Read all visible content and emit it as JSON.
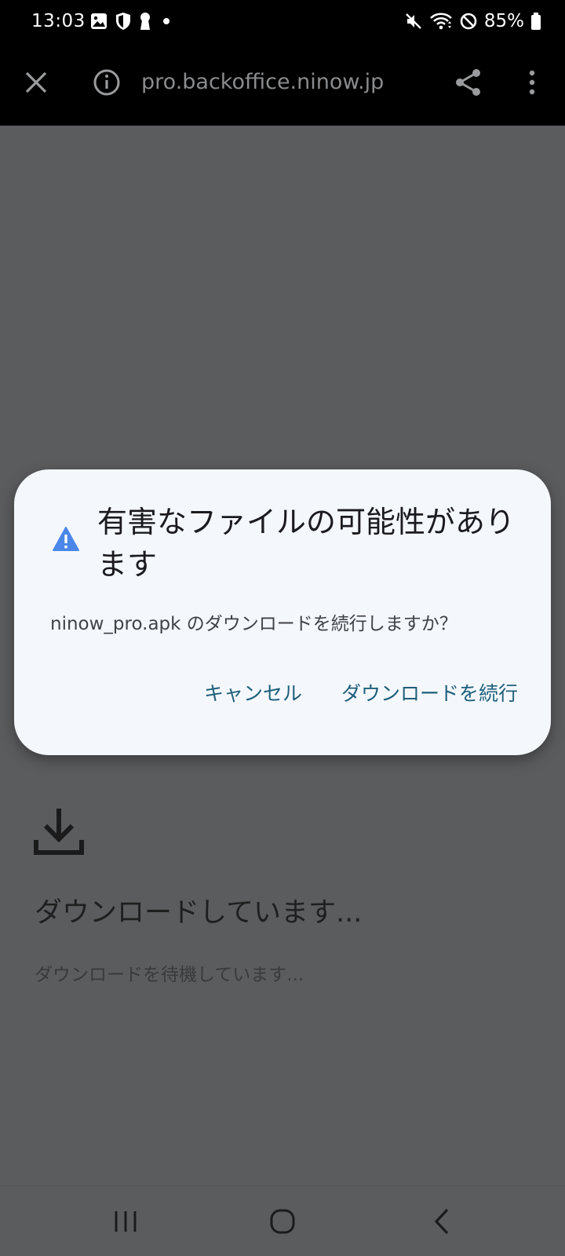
{
  "status_bar": {
    "time": "13:03",
    "battery_text": "85%",
    "icons_left": [
      "gallery-icon",
      "shield-icon",
      "keyhole-icon",
      "dot-icon"
    ],
    "icons_right": [
      "mute-icon",
      "wifi-icon",
      "blocked-icon",
      "battery-icon"
    ]
  },
  "toolbar": {
    "url": "pro.backoffice.ninow.jp",
    "icons": [
      "close-icon",
      "info-icon",
      "share-icon",
      "more-vert-icon"
    ]
  },
  "page": {
    "download_title": "ダウンロードしています...",
    "download_subtitle": "ダウンロードを待機しています..."
  },
  "dialog": {
    "title": "有害なファイルの可能性があります",
    "message": "ninow_pro.apk のダウンロードを続行しますか？",
    "cancel_label": "キャンセル",
    "continue_label": "ダウンロードを続行"
  },
  "colors": {
    "scrim": "#5b5c5e",
    "dialog_bg": "#f4f8fd",
    "accent_text": "#1f5f7a",
    "warning": "#4a87e8"
  }
}
